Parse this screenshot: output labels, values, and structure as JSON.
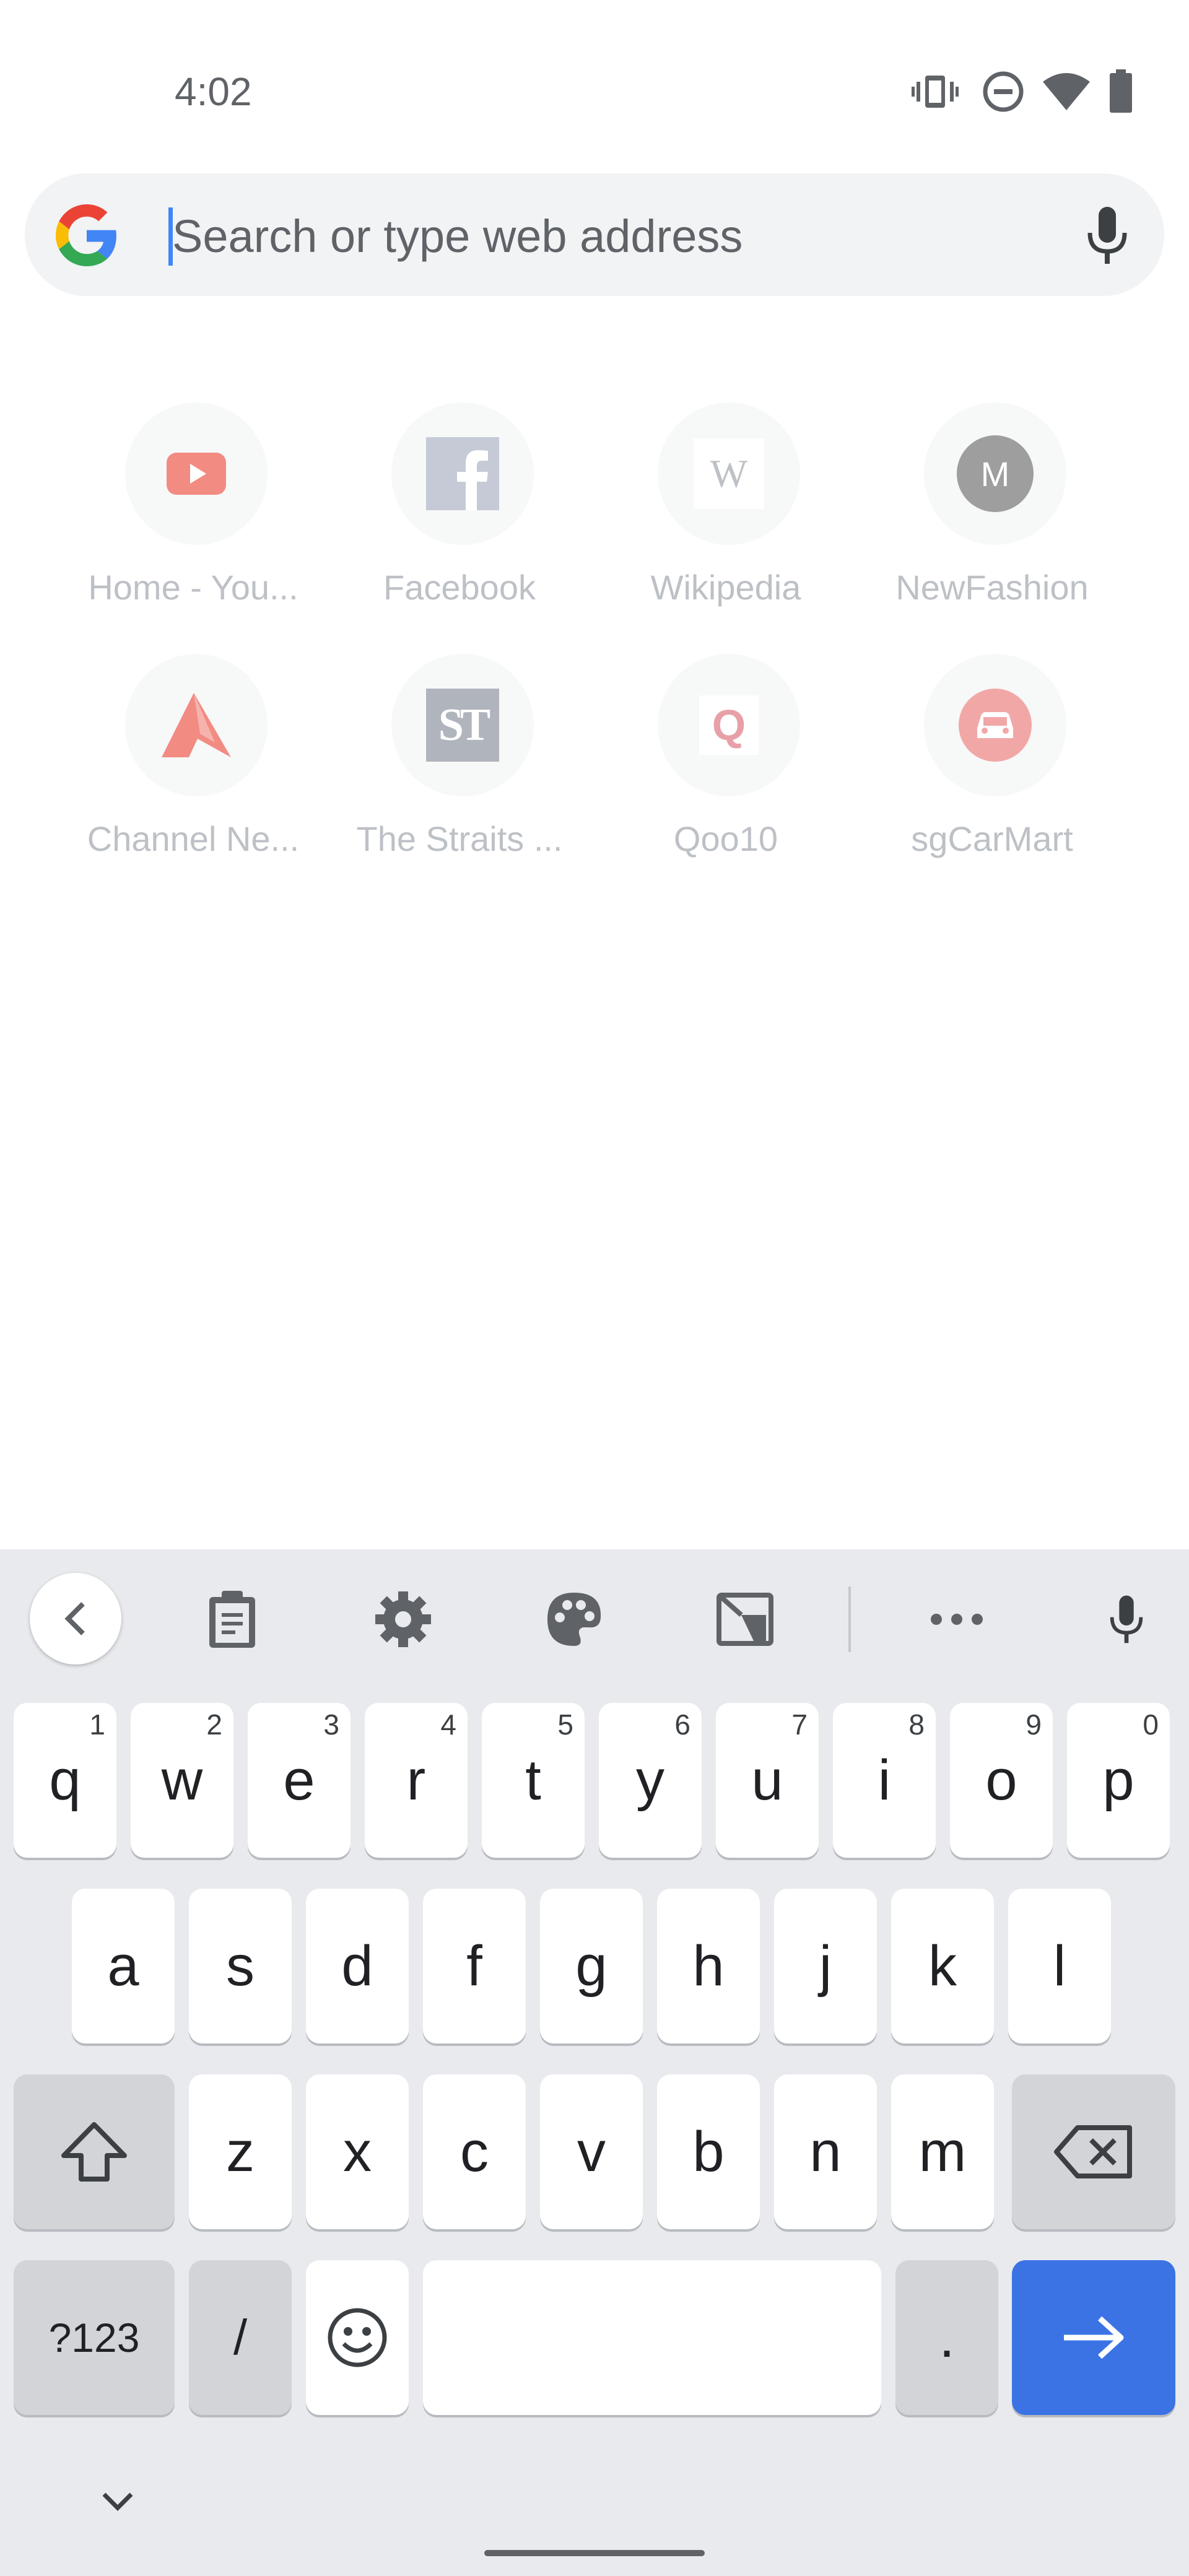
{
  "status_bar": {
    "time": "4:02",
    "icons": [
      "vibrate-icon",
      "do-not-disturb-icon",
      "wifi-icon",
      "battery-icon"
    ]
  },
  "search": {
    "placeholder": "Search or type web address",
    "logo_icon": "google-g-icon",
    "mic_icon": "microphone-icon"
  },
  "shortcuts": [
    {
      "label": "Home - You...",
      "icon": "youtube-icon",
      "color": "#f28b82"
    },
    {
      "label": "Facebook",
      "icon": "facebook-icon",
      "color": "#c5cad6"
    },
    {
      "label": "Wikipedia",
      "icon": "wikipedia-icon",
      "glyph": "W",
      "color": "#bdc1c6"
    },
    {
      "label": "NewFashion",
      "icon": "letter-avatar-icon",
      "glyph": "M",
      "color": "#9e9e9e"
    },
    {
      "label": "Channel Ne...",
      "icon": "channel-news-icon",
      "color": "#f28b82"
    },
    {
      "label": "The Straits ...",
      "icon": "straits-times-icon",
      "glyph": "ST",
      "color": "#b0b4bc"
    },
    {
      "label": "Qoo10",
      "icon": "qoo10-icon",
      "glyph": "Q",
      "color": "#e8a0a8"
    },
    {
      "label": "sgCarMart",
      "icon": "car-icon",
      "color": "#f2a7a7"
    }
  ],
  "keyboard": {
    "toolbar": [
      "back-icon",
      "clipboard-icon",
      "settings-gear-icon",
      "palette-icon",
      "crop-icon",
      "more-icon",
      "microphone-icon"
    ],
    "row1": [
      {
        "k": "q",
        "h": "1"
      },
      {
        "k": "w",
        "h": "2"
      },
      {
        "k": "e",
        "h": "3"
      },
      {
        "k": "r",
        "h": "4"
      },
      {
        "k": "t",
        "h": "5"
      },
      {
        "k": "y",
        "h": "6"
      },
      {
        "k": "u",
        "h": "7"
      },
      {
        "k": "i",
        "h": "8"
      },
      {
        "k": "o",
        "h": "9"
      },
      {
        "k": "p",
        "h": "0"
      }
    ],
    "row2": [
      "a",
      "s",
      "d",
      "f",
      "g",
      "h",
      "j",
      "k",
      "l"
    ],
    "row3": [
      "z",
      "x",
      "c",
      "v",
      "b",
      "n",
      "m"
    ],
    "symbols_label": "?123",
    "slash_label": "/",
    "period_label": ".",
    "accent_color": "#3b73e4"
  }
}
